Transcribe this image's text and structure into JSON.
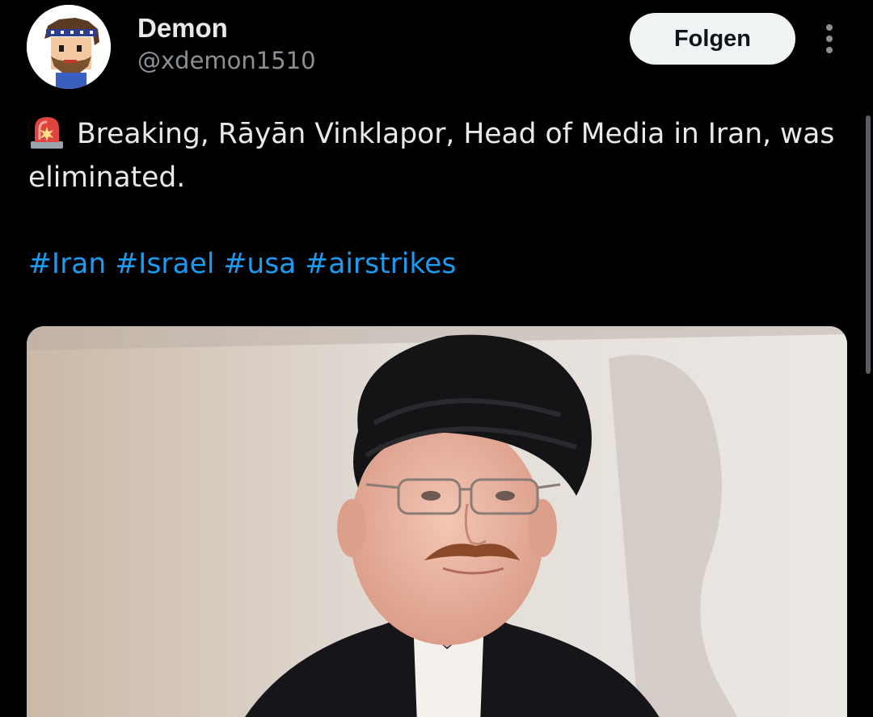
{
  "author": {
    "display_name": "Demon",
    "handle": "@xdemon1510"
  },
  "follow_button": {
    "label": "Folgen"
  },
  "post": {
    "text": "Breaking, Rāyān Vinklapor, Head of Media in Iran, was eliminated.",
    "hashtags": [
      "#Iran",
      "#Israel",
      "#usa",
      "#airstrikes"
    ]
  },
  "icons": {
    "siren": "siren-emoji-icon",
    "more": "more-vertical-icon"
  },
  "colors": {
    "background": "#000000",
    "text": "#e7e9ea",
    "secondary_text": "#8b9095",
    "link": "#1d9bf0",
    "button_bg": "#eff3f4",
    "button_text": "#0f1419"
  }
}
